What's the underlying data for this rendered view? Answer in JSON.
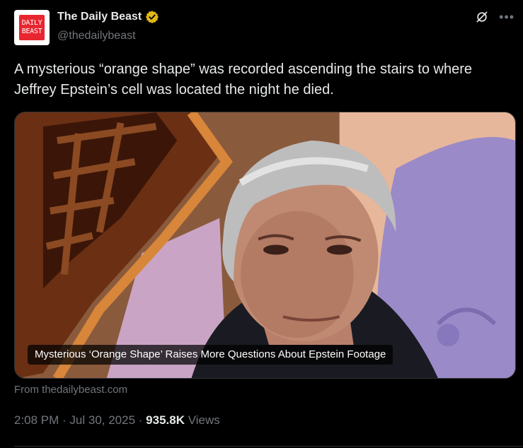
{
  "account": {
    "display_name": "The Daily Beast",
    "handle": "@thedailybeast",
    "avatar_logo": [
      "DAILY",
      "BEAST"
    ],
    "verified": true,
    "verified_color": "#e2b719"
  },
  "tweet": {
    "text": "A mysterious “orange shape” was recorded ascending the stairs to where Jeffrey Epstein’s cell was located the night he died."
  },
  "card": {
    "title": "Mysterious ‘Orange Shape’ Raises More Questions About Epstein Footage",
    "source": "From thedailybeast.com"
  },
  "meta": {
    "time": "2:08 PM",
    "sep1": " · ",
    "date": "Jul 30, 2025",
    "sep2": " · ",
    "views_count": "935.8K",
    "views_label": " Views"
  },
  "icons": {
    "grok": "grok-icon",
    "more": "more-icon",
    "verified": "verified-badge-icon"
  }
}
